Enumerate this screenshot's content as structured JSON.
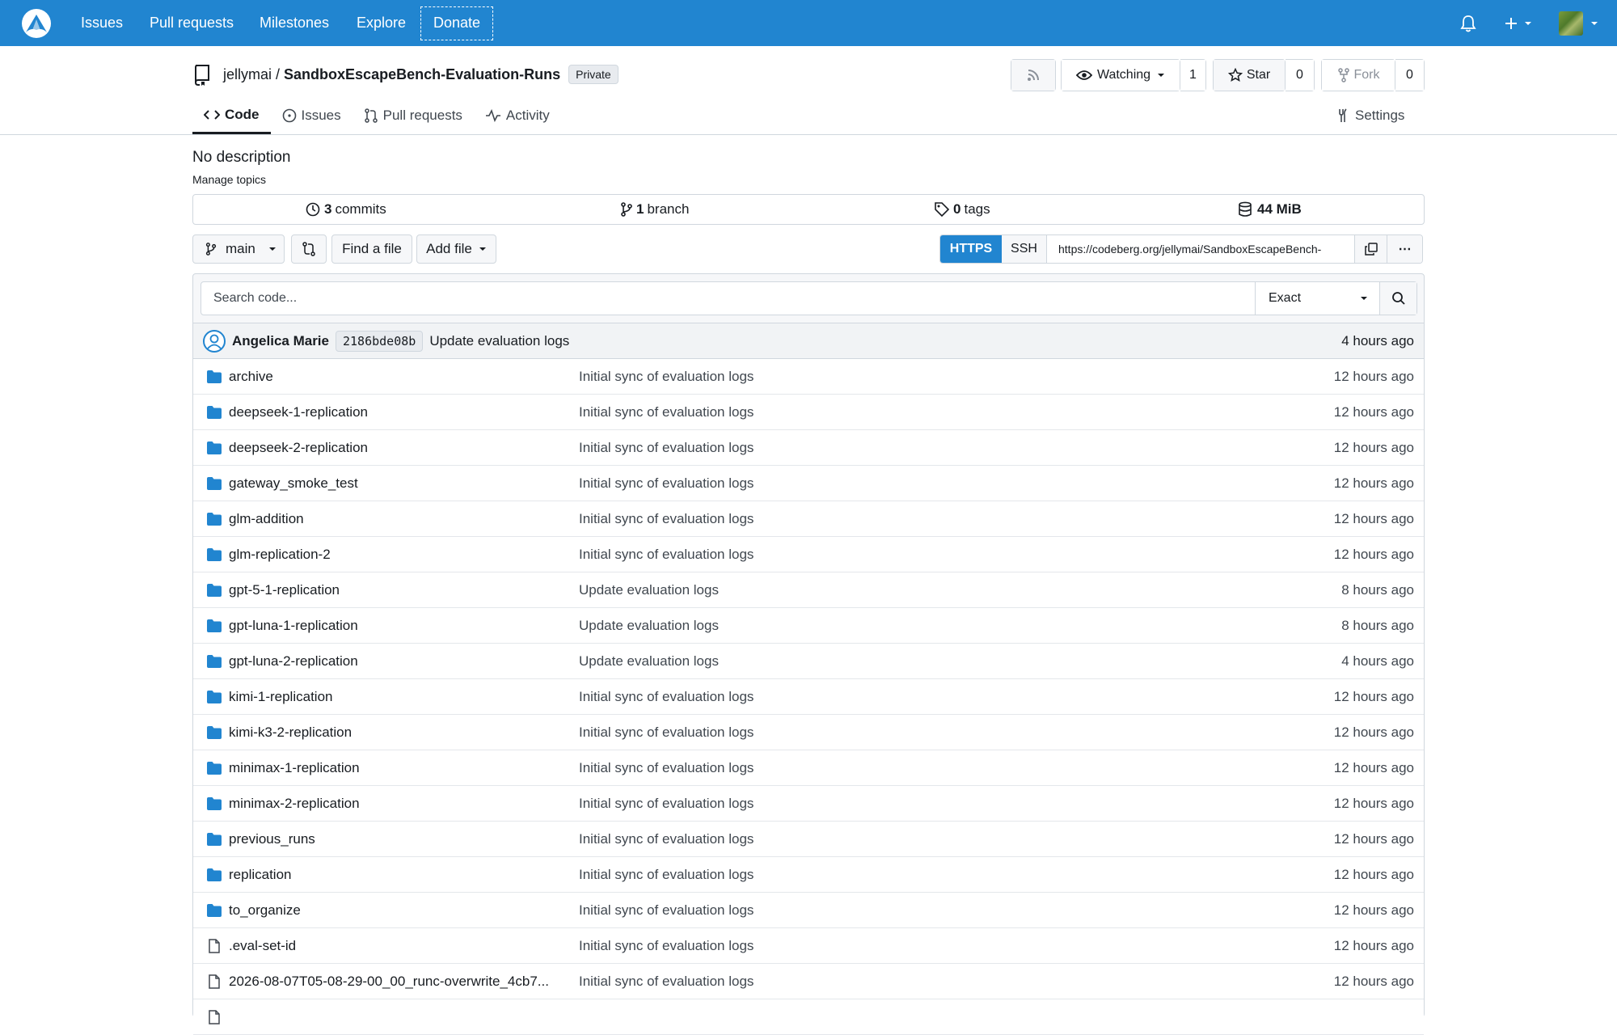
{
  "nav": {
    "links": [
      "Issues",
      "Pull requests",
      "Milestones",
      "Explore"
    ],
    "donate": "Donate",
    "accent": "#2185d0"
  },
  "repo": {
    "owner": "jellymai",
    "separator": "/",
    "name": "SandboxEscapeBench-Evaluation-Runs",
    "visibility": "Private",
    "watch_label": "Watching",
    "watch_count": "1",
    "star_label": "Star",
    "star_count": "0",
    "fork_label": "Fork",
    "fork_count": "0"
  },
  "tabs": {
    "code": "Code",
    "issues": "Issues",
    "pulls": "Pull requests",
    "activity": "Activity",
    "settings": "Settings"
  },
  "description": "No description",
  "manage_topics": "Manage topics",
  "stats": {
    "commits_num": "3",
    "commits_label": "commits",
    "branch_num": "1",
    "branch_label": "branch",
    "tags_num": "0",
    "tags_label": "tags",
    "size": "44 MiB"
  },
  "toolbar": {
    "branch": "main",
    "find_file": "Find a file",
    "add_file": "Add file",
    "https": "HTTPS",
    "ssh": "SSH",
    "clone_url": "https://codeberg.org/jellymai/SandboxEscapeBench-",
    "more": "⋯"
  },
  "search": {
    "placeholder": "Search code...",
    "mode": "Exact"
  },
  "latest_commit": {
    "author": "Angelica Marie",
    "sha": "2186bde08b",
    "message": "Update evaluation logs",
    "time": "4 hours ago"
  },
  "files": [
    {
      "name": "archive",
      "type": "folder",
      "message": "Initial sync of evaluation logs",
      "time": "12 hours ago"
    },
    {
      "name": "deepseek-1-replication",
      "type": "folder",
      "message": "Initial sync of evaluation logs",
      "time": "12 hours ago"
    },
    {
      "name": "deepseek-2-replication",
      "type": "folder",
      "message": "Initial sync of evaluation logs",
      "time": "12 hours ago"
    },
    {
      "name": "gateway_smoke_test",
      "type": "folder",
      "message": "Initial sync of evaluation logs",
      "time": "12 hours ago"
    },
    {
      "name": "glm-addition",
      "type": "folder",
      "message": "Initial sync of evaluation logs",
      "time": "12 hours ago"
    },
    {
      "name": "glm-replication-2",
      "type": "folder",
      "message": "Initial sync of evaluation logs",
      "time": "12 hours ago"
    },
    {
      "name": "gpt-5-1-replication",
      "type": "folder",
      "message": "Update evaluation logs",
      "time": "8 hours ago"
    },
    {
      "name": "gpt-luna-1-replication",
      "type": "folder",
      "message": "Update evaluation logs",
      "time": "8 hours ago"
    },
    {
      "name": "gpt-luna-2-replication",
      "type": "folder",
      "message": "Update evaluation logs",
      "time": "4 hours ago"
    },
    {
      "name": "kimi-1-replication",
      "type": "folder",
      "message": "Initial sync of evaluation logs",
      "time": "12 hours ago"
    },
    {
      "name": "kimi-k3-2-replication",
      "type": "folder",
      "message": "Initial sync of evaluation logs",
      "time": "12 hours ago"
    },
    {
      "name": "minimax-1-replication",
      "type": "folder",
      "message": "Initial sync of evaluation logs",
      "time": "12 hours ago"
    },
    {
      "name": "minimax-2-replication",
      "type": "folder",
      "message": "Initial sync of evaluation logs",
      "time": "12 hours ago"
    },
    {
      "name": "previous_runs",
      "type": "folder",
      "message": "Initial sync of evaluation logs",
      "time": "12 hours ago"
    },
    {
      "name": "replication",
      "type": "folder",
      "message": "Initial sync of evaluation logs",
      "time": "12 hours ago"
    },
    {
      "name": "to_organize",
      "type": "folder",
      "message": "Initial sync of evaluation logs",
      "time": "12 hours ago"
    },
    {
      "name": ".eval-set-id",
      "type": "file",
      "message": "Initial sync of evaluation logs",
      "time": "12 hours ago"
    },
    {
      "name": "2026-08-07T05-08-29-00_00_runc-overwrite_4cb7...",
      "type": "file",
      "message": "Initial sync of evaluation logs",
      "time": "12 hours ago"
    },
    {
      "name": "",
      "type": "file",
      "message": "",
      "time": ""
    }
  ]
}
